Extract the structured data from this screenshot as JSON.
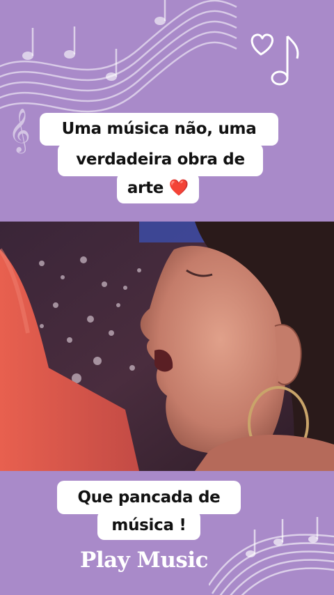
{
  "caption_top": {
    "line1": "Uma música não, uma",
    "line2": "verdadeira obra de",
    "line3_text": "arte",
    "line3_emoji": "❤️"
  },
  "caption_bottom": {
    "line1": "Que pancada de",
    "line2": "música !"
  },
  "brand": "Play Music",
  "colors": {
    "background": "#a98ac9",
    "bubble": "#ffffff",
    "text": "#111111"
  },
  "icons": [
    "music-staff-decoration",
    "heart-outline-icon",
    "music-note-icon"
  ]
}
